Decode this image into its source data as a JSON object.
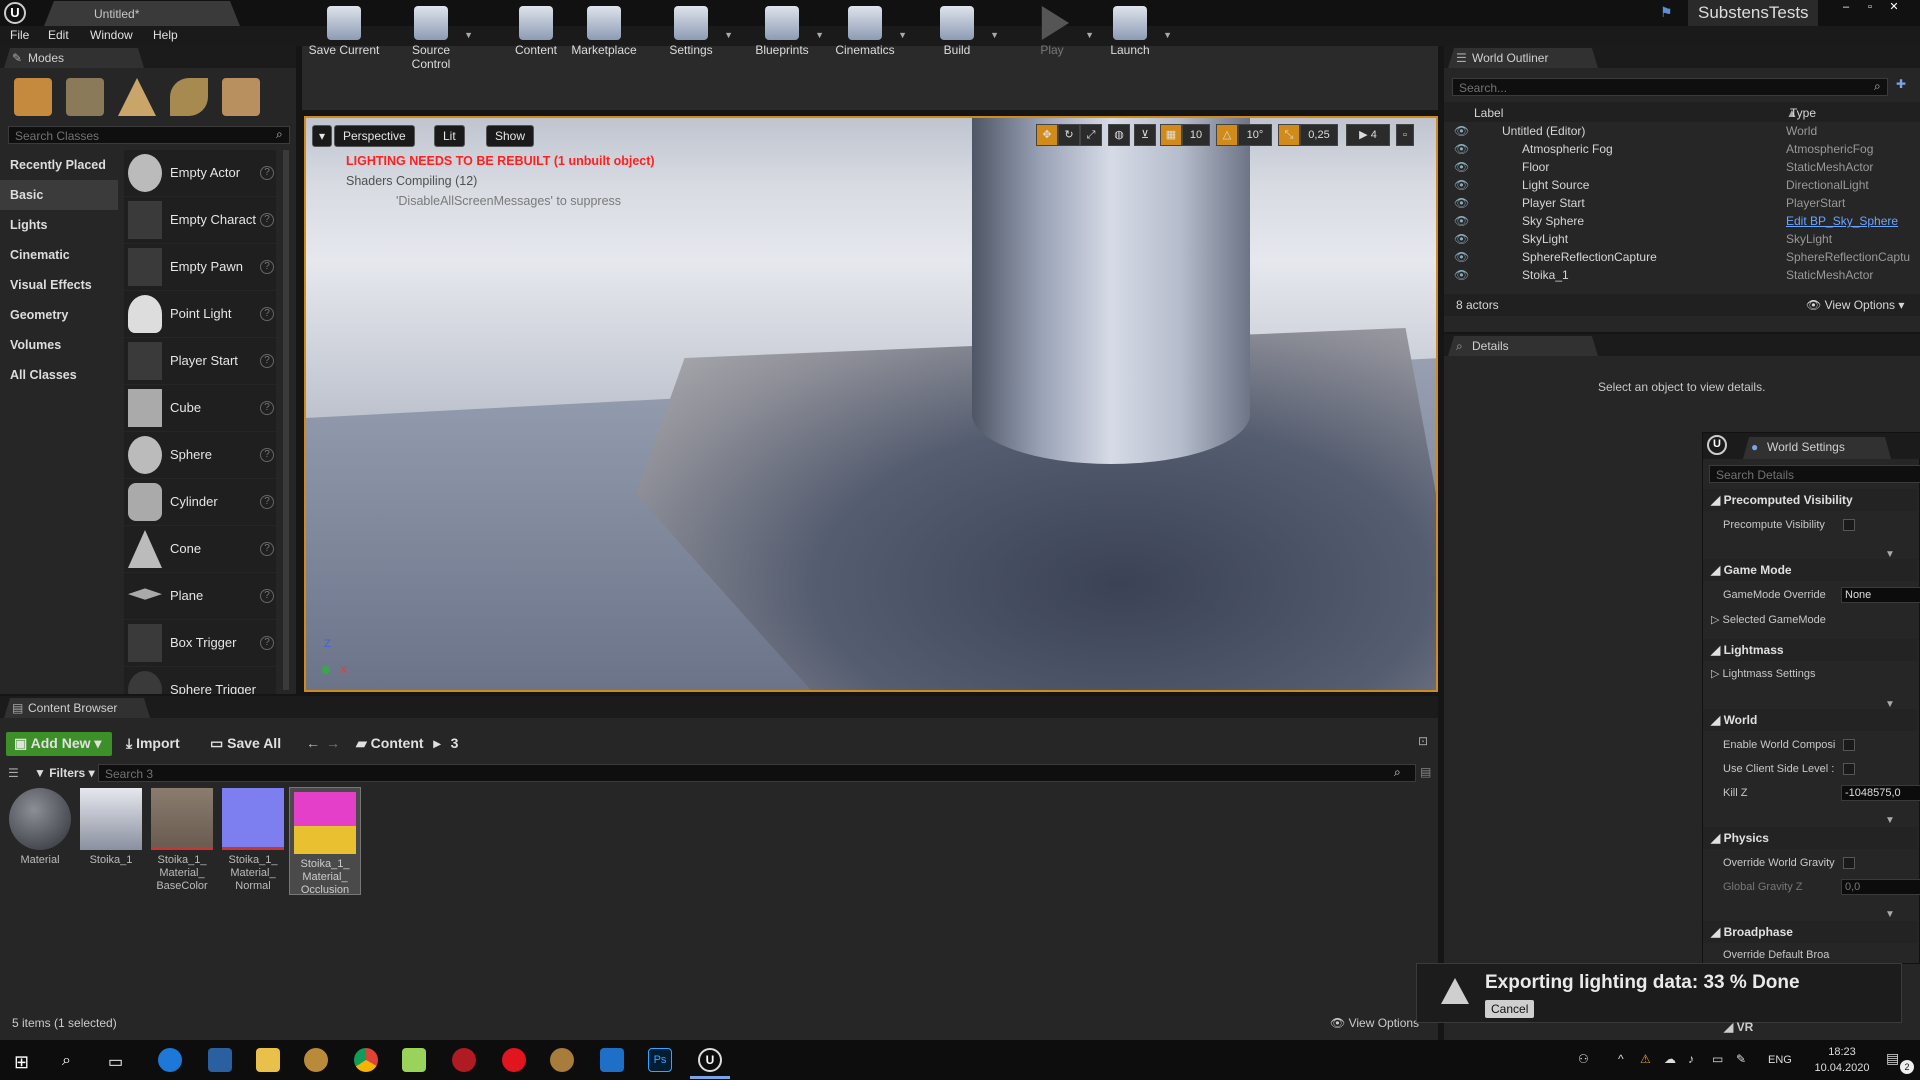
{
  "app": {
    "doc_tab": "Untitled*",
    "project": "SubstensTests",
    "window_controls": {
      "minimize": "–",
      "restore": "▫",
      "close": "✕"
    }
  },
  "menu": [
    "File",
    "Edit",
    "Window",
    "Help"
  ],
  "modes": {
    "tab": "Modes",
    "search_placeholder": "Search Classes",
    "categories": [
      "Recently Placed",
      "Basic",
      "Lights",
      "Cinematic",
      "Visual Effects",
      "Geometry",
      "Volumes",
      "All Classes"
    ],
    "selected_category": "Basic",
    "items": [
      "Empty Actor",
      "Empty Charact",
      "Empty Pawn",
      "Point Light",
      "Player Start",
      "Cube",
      "Sphere",
      "Cylinder",
      "Cone",
      "Plane",
      "Box Trigger",
      "Sphere Trigger"
    ]
  },
  "toolbar": [
    "Save Current",
    "Source Control",
    "Content",
    "Marketplace",
    "Settings",
    "Blueprints",
    "Cinematics",
    "Build",
    "Play",
    "Launch"
  ],
  "viewport": {
    "perspective": "Perspective",
    "lit": "Lit",
    "show": "Show",
    "warning": "LIGHTING NEEDS TO BE REBUILT (1 unbuilt object)",
    "shaders": "Shaders Compiling (12)",
    "suppress": "'DisableAllScreenMessages' to suppress",
    "snap_grid": "10",
    "snap_rot": "10°",
    "snap_scale": "0,25",
    "cam_speed": "4",
    "axis_z": "Z",
    "axis_x": "X"
  },
  "outliner": {
    "tab": "World Outliner",
    "search_placeholder": "Search...",
    "col_label": "Label",
    "col_type": "Type",
    "rows": [
      {
        "label": "Untitled (Editor)",
        "type": "World"
      },
      {
        "label": "Atmospheric Fog",
        "type": "AtmosphericFog"
      },
      {
        "label": "Floor",
        "type": "StaticMeshActor"
      },
      {
        "label": "Light Source",
        "type": "DirectionalLight"
      },
      {
        "label": "Player Start",
        "type": "PlayerStart"
      },
      {
        "label": "Sky Sphere",
        "type": "Edit BP_Sky_Sphere"
      },
      {
        "label": "SkyLight",
        "type": "SkyLight"
      },
      {
        "label": "SphereReflectionCapture",
        "type": "SphereReflectionCaptu"
      },
      {
        "label": "Stoika_1",
        "type": "StaticMeshActor"
      }
    ],
    "count": "8 actors",
    "view_options": "View Options"
  },
  "details": {
    "tab": "Details",
    "empty": "Select an object to view details."
  },
  "world_settings": {
    "tab": "World Settings",
    "search_placeholder": "Search Details",
    "precomputed_visibility": "Precomputed Visibility",
    "precompute_visibility": "Precompute Visibility",
    "game_mode": "Game Mode",
    "gamemode_override": "GameMode Override",
    "gamemode_value": "None",
    "selected_gamemode": "Selected GameMode",
    "lightmass": "Lightmass",
    "lightmass_settings": "Lightmass Settings",
    "world": "World",
    "enable_world_comp": "Enable World Composi",
    "use_client_side": "Use Client Side Level :",
    "kill_z": "Kill Z",
    "kill_z_value": "-1048575,0",
    "physics": "Physics",
    "override_gravity": "Override World Gravity",
    "global_gravity": "Global Gravity Z",
    "global_gravity_value": "0,0",
    "broadphase": "Broadphase",
    "override_default": "Override Default Broa",
    "vr": "VR"
  },
  "content_browser": {
    "tab": "Content Browser",
    "add_new": "Add New",
    "import": "Import",
    "save_all": "Save All",
    "path_root": "Content",
    "path_sub": "3",
    "filters": "Filters",
    "search_placeholder": "Search 3",
    "assets": [
      {
        "name": "Material"
      },
      {
        "name": "Stoika_1"
      },
      {
        "name": "Stoika_1_ Material_ BaseColor"
      },
      {
        "name": "Stoika_1_ Material_ Normal"
      },
      {
        "name": "Stoika_1_ Material_ Occlusion"
      }
    ],
    "status": "5 items (1 selected)",
    "view_options": "View Options"
  },
  "notification": {
    "text": "Exporting lighting data: 33 % Done",
    "cancel": "Cancel"
  },
  "taskbar": {
    "lang": "ENG",
    "time": "18:23",
    "date": "10.04.2020",
    "badge": "2"
  },
  "colors": {
    "accent": "#d18b1a",
    "warning": "#ff2020",
    "add_new": "#3d8f2a",
    "link": "#6aa4ff"
  }
}
